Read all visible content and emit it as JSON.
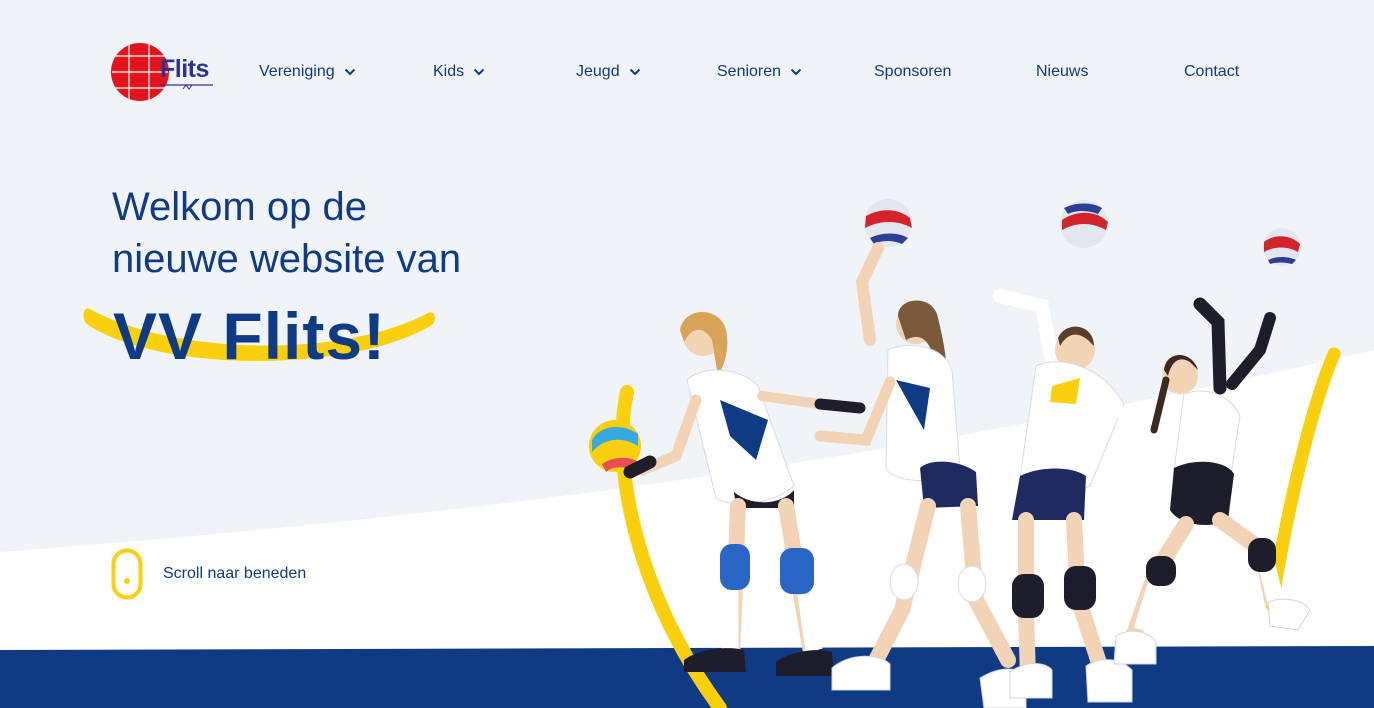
{
  "header": {
    "logo_text": "Flits",
    "nav": [
      {
        "label": "Vereniging",
        "has_dropdown": true
      },
      {
        "label": "Kids",
        "has_dropdown": true
      },
      {
        "label": "Jeugd",
        "has_dropdown": true
      },
      {
        "label": "Senioren",
        "has_dropdown": true
      },
      {
        "label": "Sponsoren",
        "has_dropdown": false
      },
      {
        "label": "Nieuws",
        "has_dropdown": false
      },
      {
        "label": "Contact",
        "has_dropdown": false
      }
    ]
  },
  "hero": {
    "line1": "Welkom op de",
    "line2": "nieuwe website van",
    "brand": "VV Flits!",
    "scroll_label": "Scroll naar beneden",
    "image": "volleyball-players-serve-sequence"
  },
  "colors": {
    "navy": "#0f3b84",
    "yellow": "#f9cf0e",
    "background": "#f0f3f7",
    "bottom_band": "#0f3b84",
    "logo_red": "#e3141b"
  },
  "icons": [
    "chevron-down-icon",
    "mouse-scroll-icon",
    "logo-ball-icon"
  ]
}
